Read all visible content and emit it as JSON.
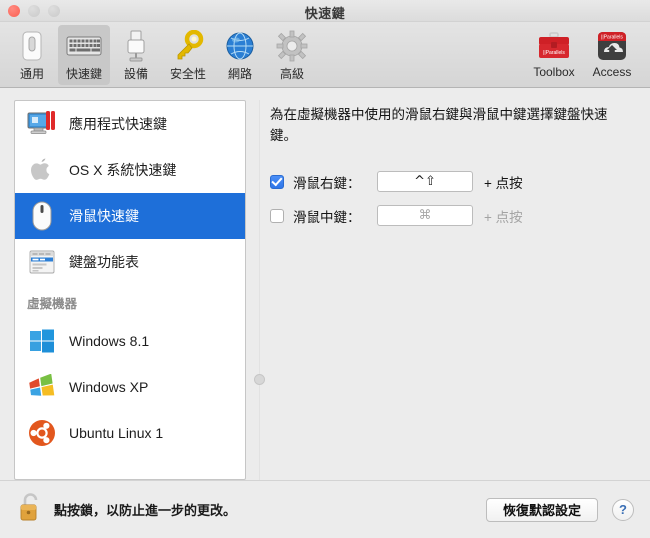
{
  "window": {
    "title": "快速鍵",
    "traffic_lights": [
      "close",
      "minimize",
      "zoom"
    ]
  },
  "toolbar": {
    "items": [
      {
        "label": "通用",
        "icon": "general-switch-icon",
        "selected": false
      },
      {
        "label": "快速鍵",
        "icon": "keyboard-icon",
        "selected": true
      },
      {
        "label": "設備",
        "icon": "usb-device-icon",
        "selected": false
      },
      {
        "label": "安全性",
        "icon": "key-icon",
        "selected": false
      },
      {
        "label": "網路",
        "icon": "globe-icon",
        "selected": false
      },
      {
        "label": "高級",
        "icon": "gear-icon",
        "selected": false
      }
    ],
    "right_items": [
      {
        "label": "Toolbox",
        "icon": "parallels-toolbox-icon"
      },
      {
        "label": "Access",
        "icon": "parallels-access-icon"
      }
    ]
  },
  "sidebar": {
    "items": [
      {
        "label": "應用程式快速鍵",
        "icon": "parallels-monitor-icon",
        "selected": false
      },
      {
        "label": "OS X 系統快速鍵",
        "icon": "apple-logo-icon",
        "selected": false
      },
      {
        "label": "滑鼠快速鍵",
        "icon": "mouse-icon",
        "selected": true
      },
      {
        "label": "鍵盤功能表",
        "icon": "menu-list-icon",
        "selected": false
      }
    ],
    "vm_section_header": "虛擬機器",
    "vm_items": [
      {
        "label": "Windows 8.1",
        "icon": "windows8-logo-icon"
      },
      {
        "label": "Windows XP",
        "icon": "windowsxp-logo-icon"
      },
      {
        "label": "Ubuntu Linux 1",
        "icon": "ubuntu-logo-icon"
      }
    ]
  },
  "main": {
    "description": "為在虛擬機器中使用的滑鼠右鍵與滑鼠中鍵選擇鍵盤快速鍵。",
    "rows": [
      {
        "label": "滑鼠右鍵：",
        "checked": true,
        "shortcut": "^⇧",
        "suffix": "+ 点按"
      },
      {
        "label": "滑鼠中鍵：",
        "checked": false,
        "shortcut": "⌘",
        "suffix": "+ 点按"
      }
    ]
  },
  "bottom": {
    "lock_icon": "open-padlock-icon",
    "lock_text": "點按鎖，以防止進一步的更改。",
    "restore_button": "恢復默認設定",
    "help_button": "?"
  },
  "colors": {
    "selection_blue": "#1e6fd9",
    "checkbox_blue": "#2f76e8",
    "parallels_red": "#d4242a",
    "ubuntu_orange": "#e2571e"
  }
}
